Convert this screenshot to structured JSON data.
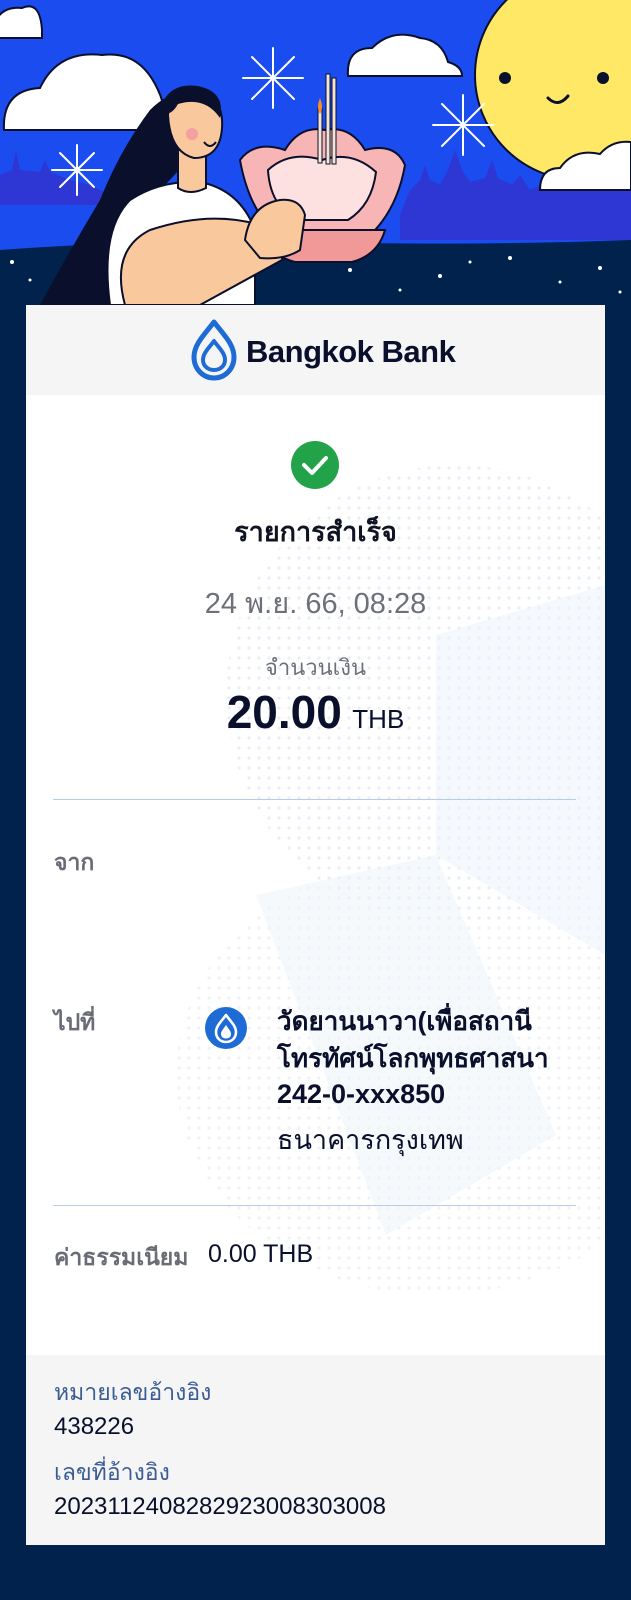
{
  "brand": {
    "name": "Bangkok Bank",
    "color": "#1e6bd6"
  },
  "status": {
    "title": "รายการสำเร็จ",
    "color": "#22a34a",
    "icon": "check-circle-icon"
  },
  "transaction": {
    "datetime": "24 พ.ย. 66, 08:28",
    "amount_label": "จำนวนเงิน",
    "amount": "20.00",
    "currency": "THB"
  },
  "from": {
    "label": "จาก"
  },
  "to": {
    "label": "ไปที่",
    "icon": "bangkok-bank-logo-icon",
    "name": "วัดยานนาวา(เพื่อสถานีโทรทัศน์โลกพุทธศาสนา",
    "account": "242-0-xxx850",
    "bank": "ธนาคารกรุงเทพ"
  },
  "fee": {
    "label": "ค่าธรรมเนียม",
    "value": "0.00 THB"
  },
  "references": {
    "ref1_label": "หมายเลขอ้างอิง",
    "ref1_value": "438226",
    "ref2_label": "เลขที่อ้างอิง",
    "ref2_value": "2023112408282923008303008"
  },
  "colors": {
    "page_background": "#00224d",
    "hero_sky": "#1a4cf0",
    "sun": "#ffe866",
    "divider": "#b7cde7",
    "label_gray": "#6a6c75",
    "ref_label": "#3a5d96"
  }
}
